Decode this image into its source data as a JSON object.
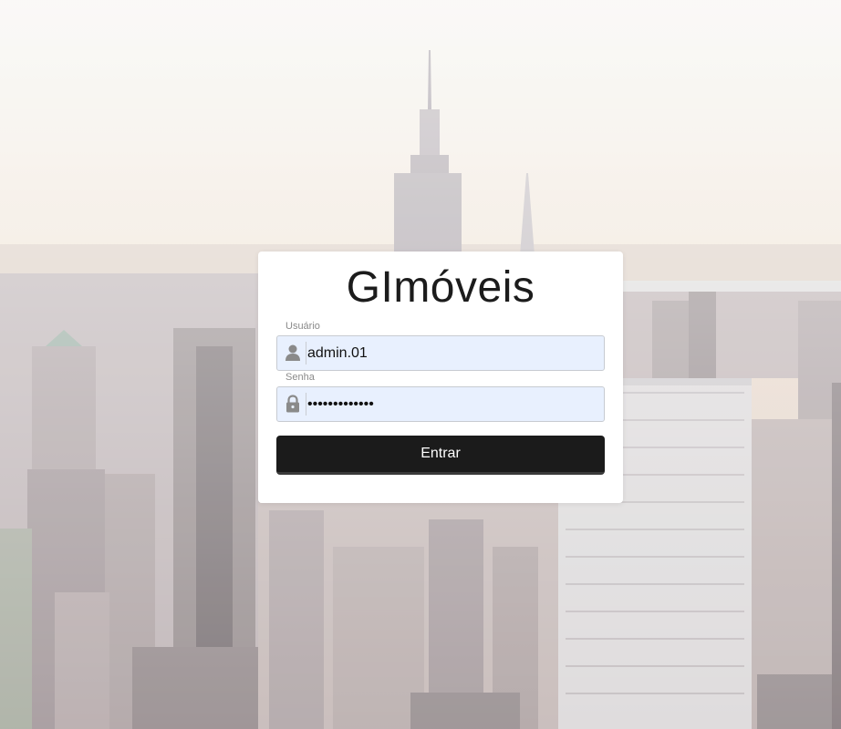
{
  "app": {
    "title": "GImóveis"
  },
  "login": {
    "username": {
      "label": "Usuário",
      "value": "admin.01",
      "icon": "user-icon"
    },
    "password": {
      "label": "Senha",
      "value": "•••••••••••••",
      "icon": "lock-icon"
    },
    "submit_label": "Entrar"
  },
  "colors": {
    "input_background": "#e8f0fe",
    "button_background": "#1b1b1b",
    "card_background": "#ffffff"
  }
}
